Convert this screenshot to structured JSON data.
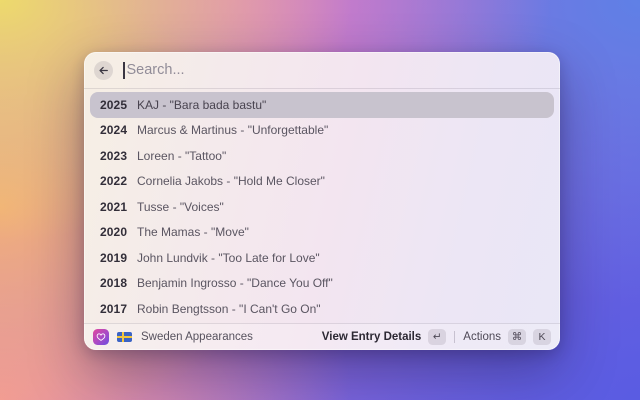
{
  "window": {
    "search": {
      "placeholder": "Search...",
      "value": ""
    },
    "rows": [
      {
        "year": "2025",
        "title": "KAJ - \"Bara bada bastu\"",
        "selected": true
      },
      {
        "year": "2024",
        "title": "Marcus & Martinus - \"Unforgettable\"",
        "selected": false
      },
      {
        "year": "2023",
        "title": "Loreen - \"Tattoo\"",
        "selected": false
      },
      {
        "year": "2022",
        "title": "Cornelia Jakobs - \"Hold Me Closer\"",
        "selected": false
      },
      {
        "year": "2021",
        "title": "Tusse - \"Voices\"",
        "selected": false
      },
      {
        "year": "2020",
        "title": "The Mamas - \"Move\"",
        "selected": false
      },
      {
        "year": "2019",
        "title": "John Lundvik - \"Too Late for Love\"",
        "selected": false
      },
      {
        "year": "2018",
        "title": "Benjamin Ingrosso - \"Dance You Off\"",
        "selected": false
      },
      {
        "year": "2017",
        "title": "Robin Bengtsson - \"I Can't Go On\"",
        "selected": false
      }
    ],
    "footer": {
      "command_name": "Sweden Appearances",
      "primary_action": "View Entry Details",
      "primary_key": "↵",
      "actions_label": "Actions",
      "actions_keys": [
        "⌘",
        "K"
      ],
      "icons": {
        "app_icon": "heart-icon",
        "flag_icon": "sweden-flag-icon"
      }
    },
    "colors": {
      "selected_row_bg": "#c8c3ce",
      "app_icon_gradient_start": "#e1489f",
      "app_icon_gradient_end": "#6b4fe0",
      "flag_blue": "#3b63c4",
      "flag_yellow": "#f2c63e",
      "bg_yellow": "#edda6c",
      "bg_pink": "#f29a96",
      "bg_blue": "#5f80e6",
      "bg_violet": "#5a5ce2"
    }
  }
}
